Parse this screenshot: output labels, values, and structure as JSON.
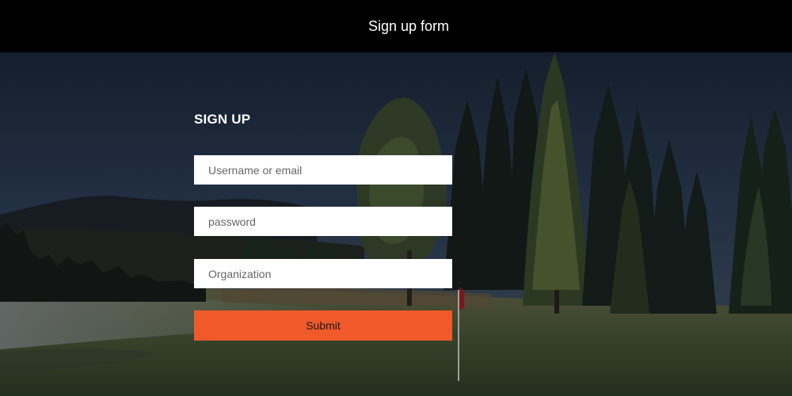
{
  "header": {
    "title": "Sign up form"
  },
  "form": {
    "title": "SIGN UP",
    "fields": [
      {
        "placeholder": "Username or email",
        "value": ""
      },
      {
        "placeholder": "password",
        "value": ""
      },
      {
        "placeholder": "Organization",
        "value": ""
      }
    ],
    "submit_label": "Submit"
  },
  "colors": {
    "header_bg": "#000000",
    "accent": "#f05a2a",
    "field_bg": "#ffffff"
  },
  "background": {
    "description_icon": "golf-course-landscape-image"
  }
}
